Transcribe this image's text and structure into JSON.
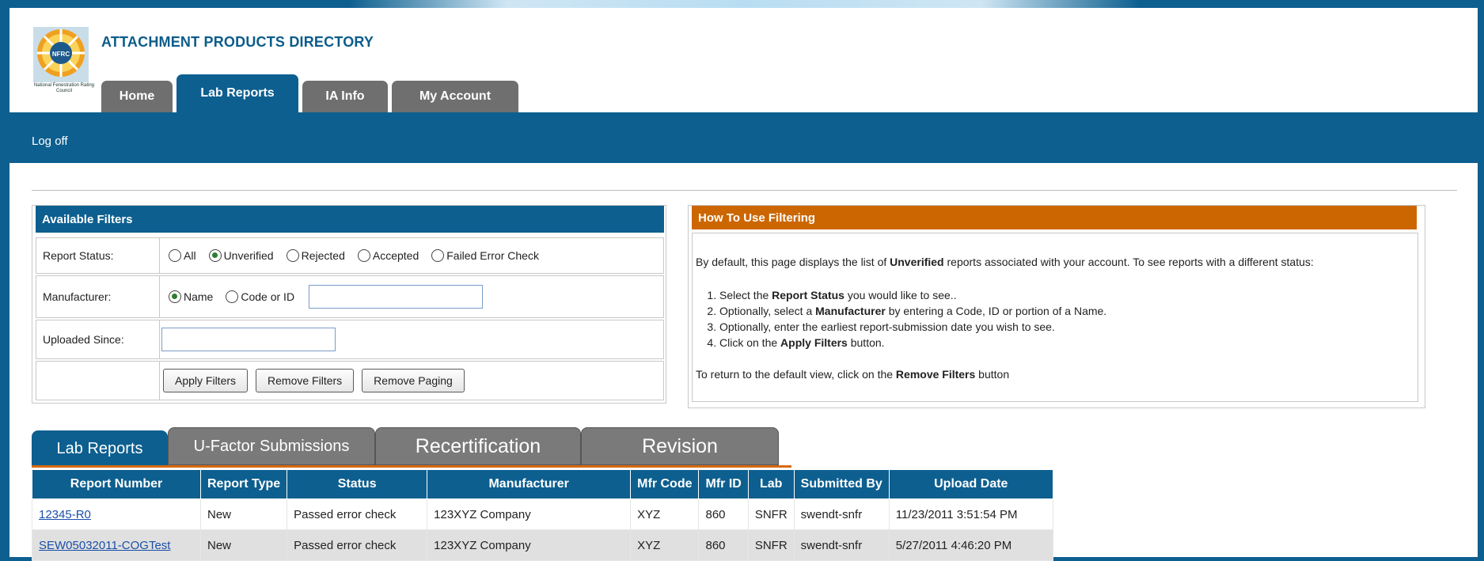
{
  "header": {
    "title": "ATTACHMENT PRODUCTS DIRECTORY",
    "logo_acronym": "NFRC",
    "logo_org": "National Fenestration Rating Council"
  },
  "main_tabs": [
    {
      "label": "Home",
      "active": false
    },
    {
      "label": "Lab Reports",
      "active": true
    },
    {
      "label": "IA Info",
      "active": false
    },
    {
      "label": "My Account",
      "active": false
    }
  ],
  "nav": {
    "logoff": "Log off"
  },
  "filters": {
    "title": "Available Filters",
    "report_status": {
      "label": "Report Status:",
      "options": [
        "All",
        "Unverified",
        "Rejected",
        "Accepted",
        "Failed Error Check"
      ],
      "selected": "Unverified"
    },
    "manufacturer": {
      "label": "Manufacturer:",
      "options": [
        "Name",
        "Code or ID"
      ],
      "selected": "Name",
      "value": ""
    },
    "uploaded_since": {
      "label": "Uploaded Since:",
      "value": ""
    },
    "buttons": {
      "apply": "Apply Filters",
      "remove": "Remove Filters",
      "remove_paging": "Remove Paging"
    }
  },
  "howto": {
    "title": "How To Use Filtering",
    "intro_a": "By default, this page displays the list of ",
    "intro_b": "Unverified",
    "intro_c": " reports associated with your account. To see reports with a different status:",
    "steps": [
      {
        "a": "Select the ",
        "b": "Report Status",
        "c": " you would like to see.."
      },
      {
        "a": "Optionally, select a ",
        "b": "Manufacturer",
        "c": " by entering a Code, ID or portion of a Name."
      },
      {
        "a": "Optionally, enter the earliest report-submission date you wish to see.",
        "b": "",
        "c": ""
      },
      {
        "a": "Click on the ",
        "b": "Apply Filters",
        "c": " button."
      }
    ],
    "outro_a": "To return to the default view, click on the ",
    "outro_b": "Remove Filters",
    "outro_c": " button"
  },
  "result_tabs": [
    {
      "label": "Lab Reports",
      "active": true
    },
    {
      "label": "U-Factor Submissions",
      "active": false
    },
    {
      "label": "Recertification",
      "active": false
    },
    {
      "label": "Revision",
      "active": false
    }
  ],
  "table": {
    "headers": [
      "Report Number",
      "Report Type",
      "Status",
      "Manufacturer",
      "Mfr Code",
      "Mfr ID",
      "Lab",
      "Submitted By",
      "Upload Date"
    ],
    "rows": [
      [
        "12345-R0",
        "New",
        "Passed error check",
        "123XYZ Company",
        "XYZ",
        "860",
        "SNFR",
        "swendt-snfr",
        "11/23/2011 3:51:54 PM"
      ],
      [
        "SEW05032011-COGTest",
        "New",
        "Passed error check",
        "123XYZ Company",
        "XYZ",
        "860",
        "SNFR",
        "swendt-snfr",
        "5/27/2011 4:46:20 PM"
      ]
    ]
  },
  "colors": {
    "primary": "#0d5f8f",
    "accent": "#cc6600",
    "tab_inactive": "#6f6f6f"
  }
}
